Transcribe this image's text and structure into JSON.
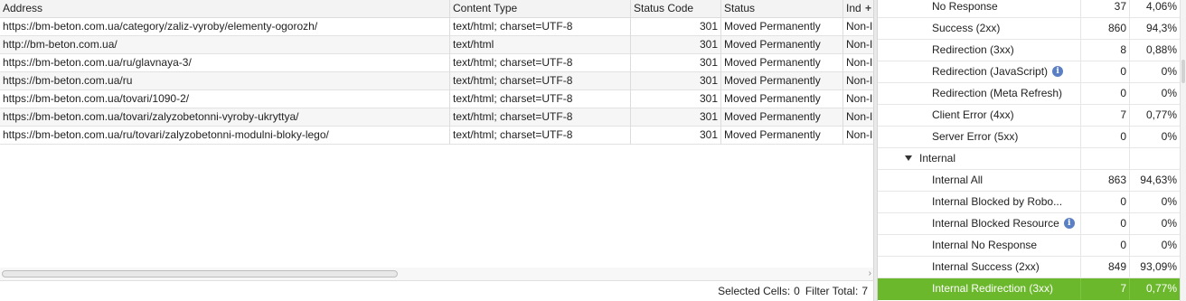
{
  "table": {
    "columns": [
      "Address",
      "Content Type",
      "Status Code",
      "Status",
      "Ind"
    ],
    "add_column_icon": "+",
    "rows": [
      {
        "address": "https://bm-beton.com.ua/category/zaliz-vyroby/elementy-ogorozh/",
        "content_type": "text/html; charset=UTF-8",
        "status_code": "301",
        "status": "Moved Permanently",
        "ind": "Non-I"
      },
      {
        "address": "http://bm-beton.com.ua/",
        "content_type": "text/html",
        "status_code": "301",
        "status": "Moved Permanently",
        "ind": "Non-I"
      },
      {
        "address": "https://bm-beton.com.ua/ru/glavnaya-3/",
        "content_type": "text/html; charset=UTF-8",
        "status_code": "301",
        "status": "Moved Permanently",
        "ind": "Non-I"
      },
      {
        "address": "https://bm-beton.com.ua/ru",
        "content_type": "text/html; charset=UTF-8",
        "status_code": "301",
        "status": "Moved Permanently",
        "ind": "Non-I"
      },
      {
        "address": "https://bm-beton.com.ua/tovari/1090-2/",
        "content_type": "text/html; charset=UTF-8",
        "status_code": "301",
        "status": "Moved Permanently",
        "ind": "Non-I"
      },
      {
        "address": "https://bm-beton.com.ua/tovari/zalyzobetonni-vyroby-ukryttya/",
        "content_type": "text/html; charset=UTF-8",
        "status_code": "301",
        "status": "Moved Permanently",
        "ind": "Non-I"
      },
      {
        "address": "https://bm-beton.com.ua/ru/tovari/zalyzobetonni-modulni-bloky-lego/",
        "content_type": "text/html; charset=UTF-8",
        "status_code": "301",
        "status": "Moved Permanently",
        "ind": "Non-I"
      }
    ]
  },
  "statusbar": {
    "selected_label": "Selected Cells:",
    "selected_value": "0",
    "filter_label": "Filter Total:",
    "filter_value": "7"
  },
  "overview": {
    "rows": [
      {
        "name": "No Response",
        "count": "37",
        "pct": "4,06%"
      },
      {
        "name": "Success (2xx)",
        "count": "860",
        "pct": "94,3%"
      },
      {
        "name": "Redirection (3xx)",
        "count": "8",
        "pct": "0,88%"
      },
      {
        "name": "Redirection (JavaScript)",
        "count": "0",
        "pct": "0%",
        "info": true
      },
      {
        "name": "Redirection (Meta Refresh)",
        "count": "0",
        "pct": "0%"
      },
      {
        "name": "Client Error (4xx)",
        "count": "7",
        "pct": "0,77%"
      },
      {
        "name": "Server Error (5xx)",
        "count": "0",
        "pct": "0%"
      },
      {
        "name": "Internal",
        "count": "",
        "pct": "",
        "section": true
      },
      {
        "name": "Internal All",
        "count": "863",
        "pct": "94,63%"
      },
      {
        "name": "Internal Blocked by Robo...",
        "count": "0",
        "pct": "0%"
      },
      {
        "name": "Internal Blocked Resource",
        "count": "0",
        "pct": "0%",
        "info": true
      },
      {
        "name": "Internal No Response",
        "count": "0",
        "pct": "0%"
      },
      {
        "name": "Internal Success (2xx)",
        "count": "849",
        "pct": "93,09%"
      },
      {
        "name": "Internal Redirection (3xx)",
        "count": "7",
        "pct": "0,77%",
        "selected": true
      }
    ],
    "selected_color": "#6bb82c",
    "info_icon": "info-icon"
  }
}
